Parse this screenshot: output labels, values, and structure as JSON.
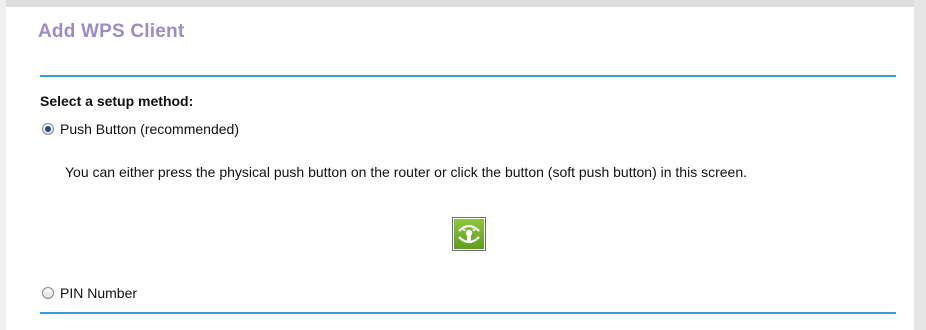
{
  "page": {
    "title": "Add WPS Client"
  },
  "setup": {
    "label": "Select a setup method:",
    "options": [
      {
        "label": "Push Button (recommended)",
        "selected": true
      },
      {
        "label": "PIN Number",
        "selected": false
      }
    ],
    "push_description": "You can either press the physical push button on the router or click the button (soft push button) in this screen."
  },
  "wps_button": {
    "icon": "wps-push-icon"
  },
  "colors": {
    "title": "#9b8bc7",
    "rule": "#3a9bd5",
    "button_green": "#7ab648"
  }
}
